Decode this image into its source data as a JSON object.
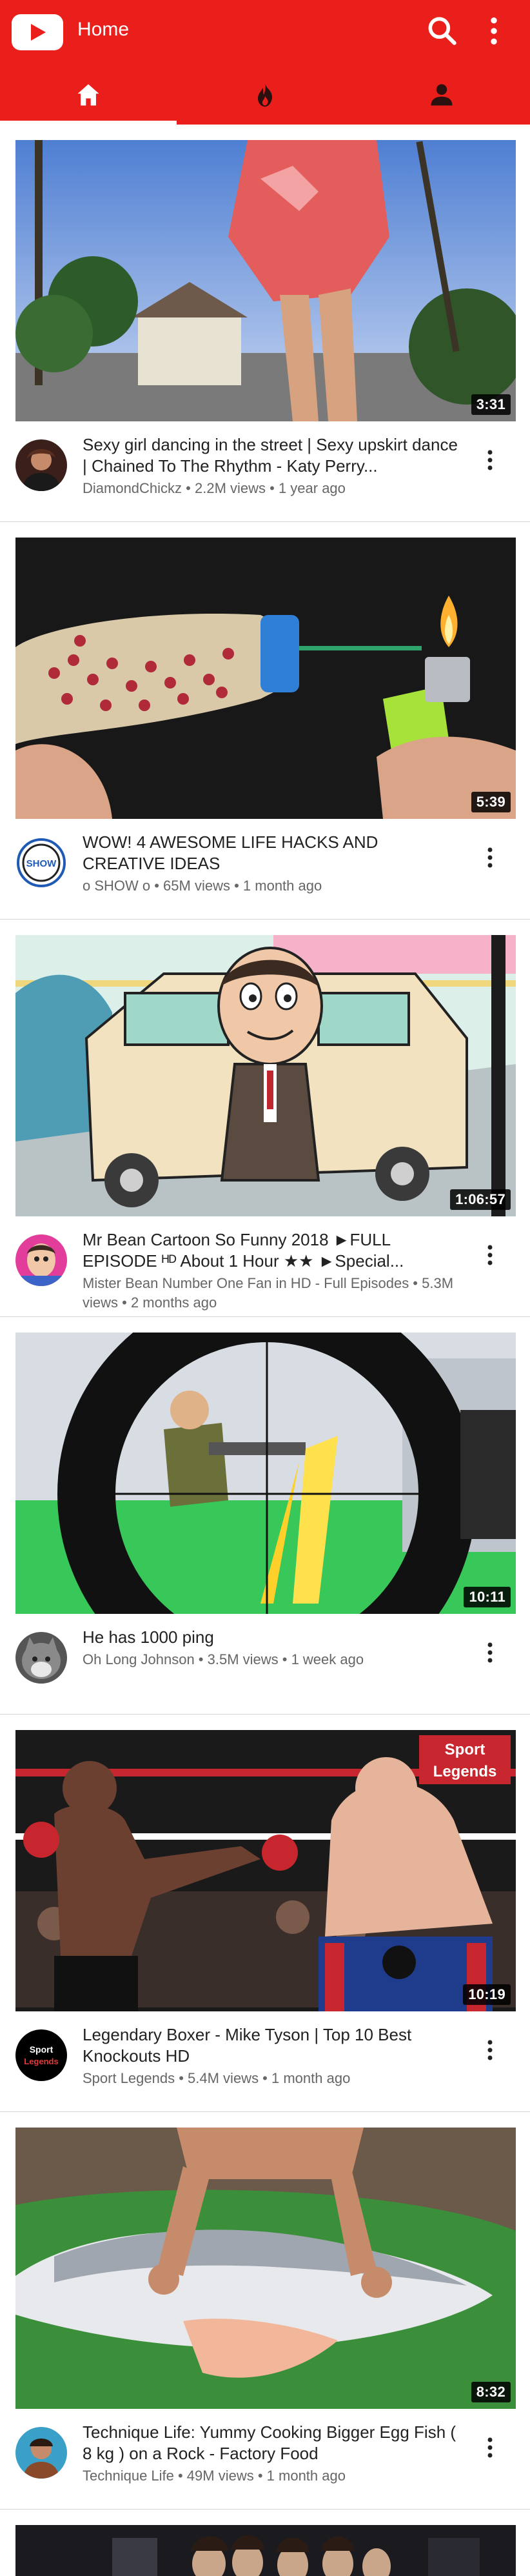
{
  "app": {
    "title": "Home",
    "tabs": [
      {
        "label": "",
        "icon": "home-icon",
        "active": true
      },
      {
        "label": "",
        "icon": "trending-flame-icon",
        "active": false
      },
      {
        "label": "",
        "icon": "account-icon",
        "active": false
      }
    ],
    "icons": {
      "logo": "youtube-logo-icon",
      "search": "search-icon",
      "more": "more-vert-icon"
    }
  },
  "colors": {
    "accent": "#ea1f1c",
    "title_text": "#212121",
    "meta_text": "#666666",
    "divider": "#d4d4d4"
  },
  "videos": [
    {
      "title": "Sexy girl dancing in the street | Sexy upskirt dance | Chained To The Rhythm - Katy Perry...",
      "channel_line": "DiamondChickz • 2.2M views • 1 year ago",
      "duration": "3:31",
      "thumbnail": "street dance scene with palm trees",
      "avatar": "dancer-avatar"
    },
    {
      "title": "WOW! 4 AWESOME LIFE HACKS AND CREATIVE IDEAS",
      "channel_line": "o SHOW o • 65M views • 1 month ago",
      "duration": "5:39",
      "thumbnail": "matches in bottle and lighter",
      "avatar": "show-logo-avatar",
      "avatar_text": "SHOW"
    },
    {
      "title": "Mr Bean Cartoon So Funny 2018 ►FULL EPISODE ᴴᴰ About 1 Hour ★★ ►Special...",
      "channel_line": "Mister Bean Number One Fan in HD - Full Episodes • 5.3M views • 2 months ago",
      "duration": "1:06:57",
      "thumbnail": "cartoon man beside car",
      "avatar": "cartoon-avatar"
    },
    {
      "title": "He has 1000 ping",
      "channel_line": "Oh Long Johnson • 3.5M views • 1 week ago",
      "duration": "10:11",
      "thumbnail": "sniper scope over soldier",
      "avatar": "cat-avatar"
    },
    {
      "title": "Legendary Boxer - Mike Tyson | Top 10 Best Knockouts HD",
      "channel_line": "Sport Legends • 5.4M views • 1 month ago",
      "duration": "10:19",
      "thumbnail": "boxing match",
      "thumb_badge": [
        "Sport",
        "Legends"
      ],
      "avatar": "sport-legends-avatar",
      "avatar_text": [
        "Sport",
        "Legends"
      ]
    },
    {
      "title": "Technique Life: Yummy Cooking Bigger Egg Fish ( 8 kg ) on a Rock - Factory Food",
      "channel_line": "Technique Life • 49M views • 1 month ago",
      "duration": "8:32",
      "thumbnail": "large fish on banana leaf",
      "avatar": "technique-life-avatar"
    },
    {
      "title": "",
      "channel_line": "",
      "duration": "",
      "thumbnail": "people portrait strip",
      "avatar": ""
    }
  ]
}
